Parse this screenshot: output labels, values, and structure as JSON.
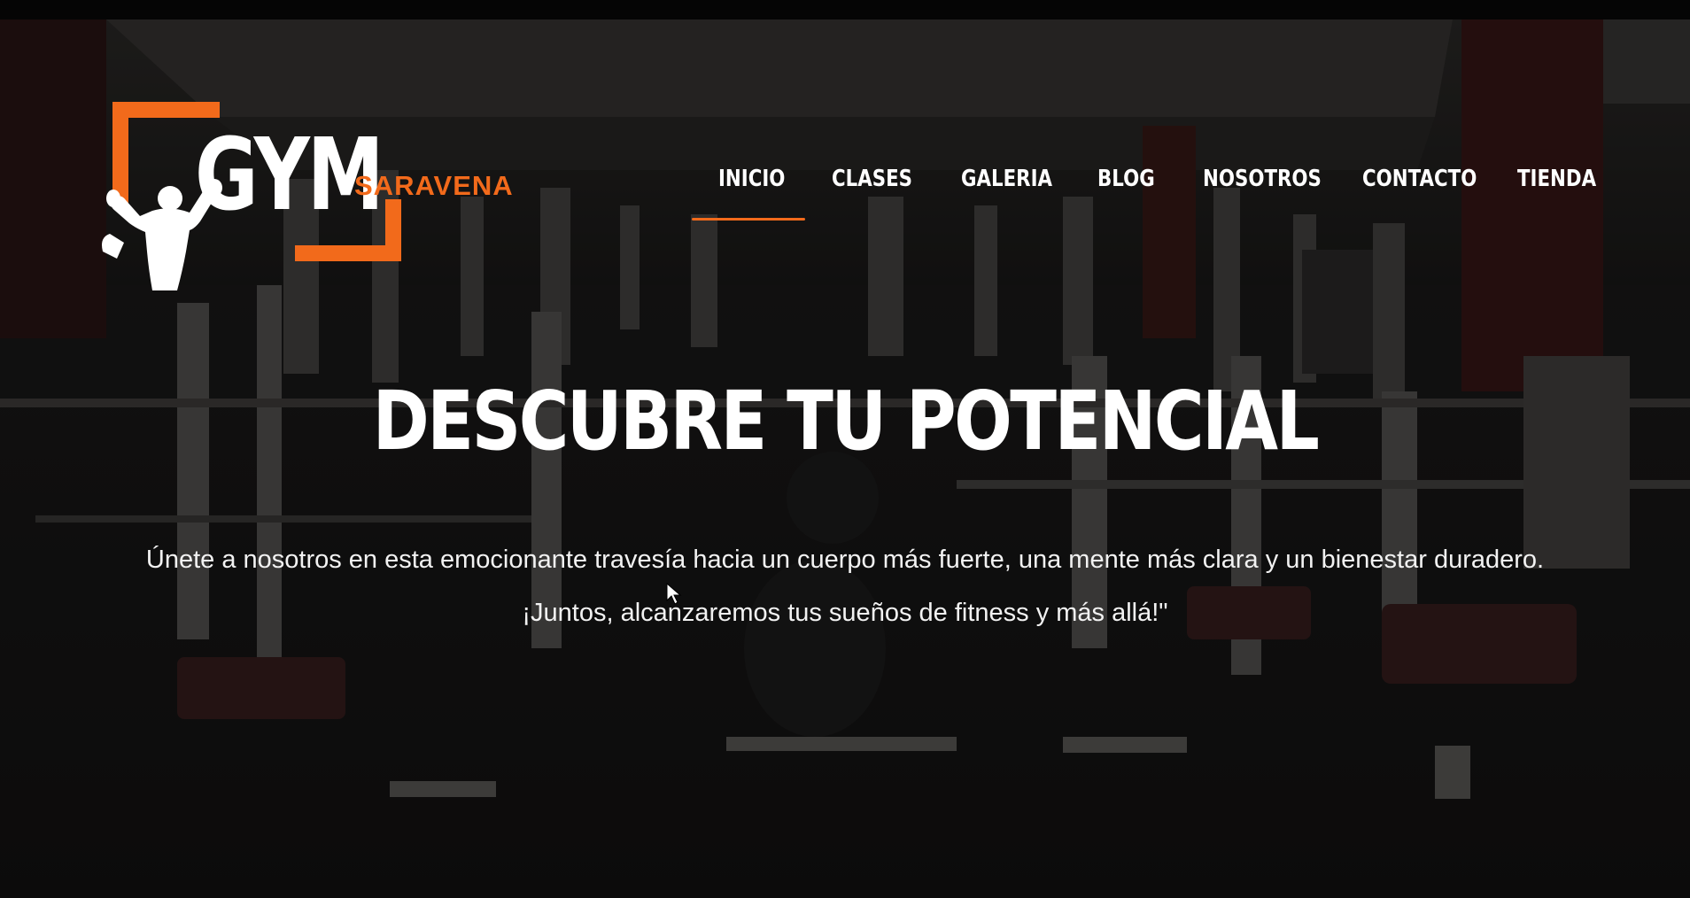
{
  "brand": {
    "name": "GYM",
    "subtitle": "SARAVENA",
    "accent_color": "#f26a1b"
  },
  "nav": {
    "items": [
      {
        "label": "INICIO",
        "active": true
      },
      {
        "label": "CLASES",
        "active": false
      },
      {
        "label": "GALERIA",
        "active": false
      },
      {
        "label": "BLOG",
        "active": false
      },
      {
        "label": "NOSOTROS",
        "active": false
      },
      {
        "label": "CONTACTO",
        "active": false
      },
      {
        "label": "TIENDA",
        "active": false
      }
    ]
  },
  "hero": {
    "title": "DESCUBRE TU POTENCIAL",
    "line1": "Únete a nosotros en esta emocionante travesía hacia un cuerpo más fuerte, una mente más clara y un bienestar duradero.",
    "line2": "¡Juntos, alcanzaremos tus sueños de fitness y más allá!\"",
    "background": "gym-interior-photo"
  },
  "icons": {
    "logo_figure": "bodybuilder-icon",
    "cursor": "mouse-pointer-icon"
  }
}
